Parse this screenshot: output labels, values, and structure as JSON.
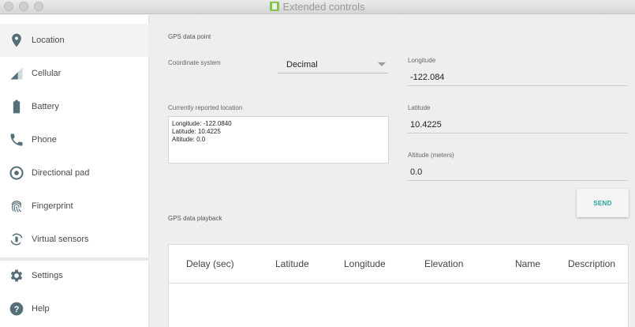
{
  "window": {
    "title": "Extended controls"
  },
  "sidebar": {
    "items": [
      {
        "label": "Location",
        "icon": "location-pin-icon"
      },
      {
        "label": "Cellular",
        "icon": "cellular-signal-icon"
      },
      {
        "label": "Battery",
        "icon": "battery-icon"
      },
      {
        "label": "Phone",
        "icon": "phone-icon"
      },
      {
        "label": "Directional pad",
        "icon": "dpad-icon"
      },
      {
        "label": "Fingerprint",
        "icon": "fingerprint-icon"
      },
      {
        "label": "Virtual sensors",
        "icon": "rotation-sensor-icon"
      },
      {
        "label": "Settings",
        "icon": "gear-icon"
      },
      {
        "label": "Help",
        "icon": "help-icon"
      }
    ],
    "active": "Location"
  },
  "gps": {
    "section_label": "GPS data point",
    "coord_system_label": "Coordinate system",
    "coord_system_value": "Decimal",
    "current_location_label": "Currently reported location",
    "current_location_lines": [
      "Longitude: -122.0840",
      "Latitude: 10.4225",
      "Altitude: 0.0"
    ],
    "longitude_label": "Longitude",
    "longitude_value": "-122.084",
    "latitude_label": "Latitude",
    "latitude_value": "10.4225",
    "altitude_label": "Altitude (meters)",
    "altitude_value": "0.0",
    "send_label": "SEND"
  },
  "playback": {
    "section_label": "GPS data playback",
    "columns": [
      "Delay (sec)",
      "Latitude",
      "Longitude",
      "Elevation",
      "Name",
      "Description"
    ]
  },
  "colors": {
    "accent": "#26a69a",
    "icon": "#546e7a",
    "title_icon": "#8bc34a"
  }
}
